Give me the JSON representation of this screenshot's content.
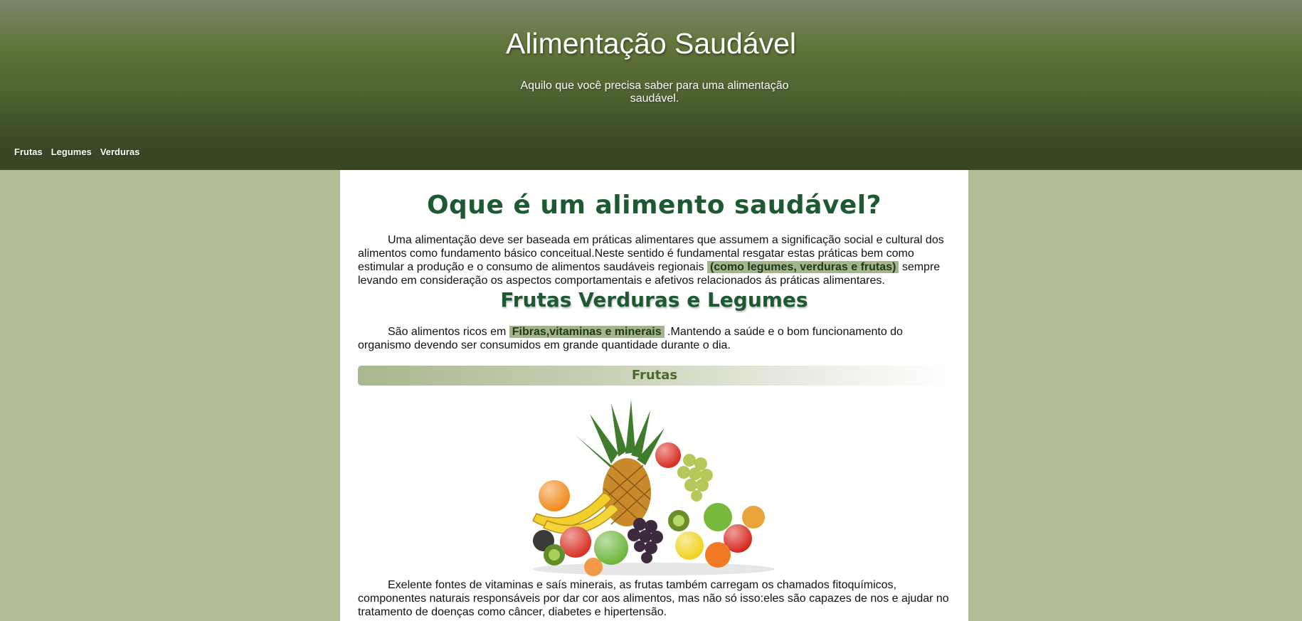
{
  "header": {
    "title": "Alimentação Saudável",
    "subtitle": "Aquilo que você precisa saber para uma alimentação saudável."
  },
  "nav": {
    "items": [
      {
        "label": "Frutas"
      },
      {
        "label": "Legumes"
      },
      {
        "label": "Verduras"
      }
    ]
  },
  "main": {
    "heading": "Oque é um alimento saudável?",
    "intro": {
      "before": "Uma alimentação deve ser baseada em práticas alimentares que assumem a significação social e cultural dos alimentos como fundamento básico conceitual.Neste sentido é fundamental resgatar estas práticas bem como estimular a produção e o consumo de alimentos saudáveis regionais ",
      "highlight": "(como legumes, verduras e frutas)",
      "after": " sempre levando em consideração os aspectos comportamentais e afetivos relacionados ás práticas alimentares."
    },
    "subheading": "Frutas Verduras e Legumes",
    "rich": {
      "before": "São alimentos ricos em ",
      "highlight": "Fibras,vitaminas e minerais",
      "after": " .Mantendo a saúde e o bom funcionamento do organismo devendo ser consumidos em grande quantidade durante o dia."
    },
    "section_title": "Frutas",
    "fruits_text": "Exelente fontes de vitaminas e saís minerais, as frutas também carregam os chamados fitoquímicos, componentes naturais responsáveis por dar cor aos alimentos, mas não só isso:eles são capazes de nos e ajudar no tratamento de doenças como câncer, diabetes e hipertensão."
  }
}
